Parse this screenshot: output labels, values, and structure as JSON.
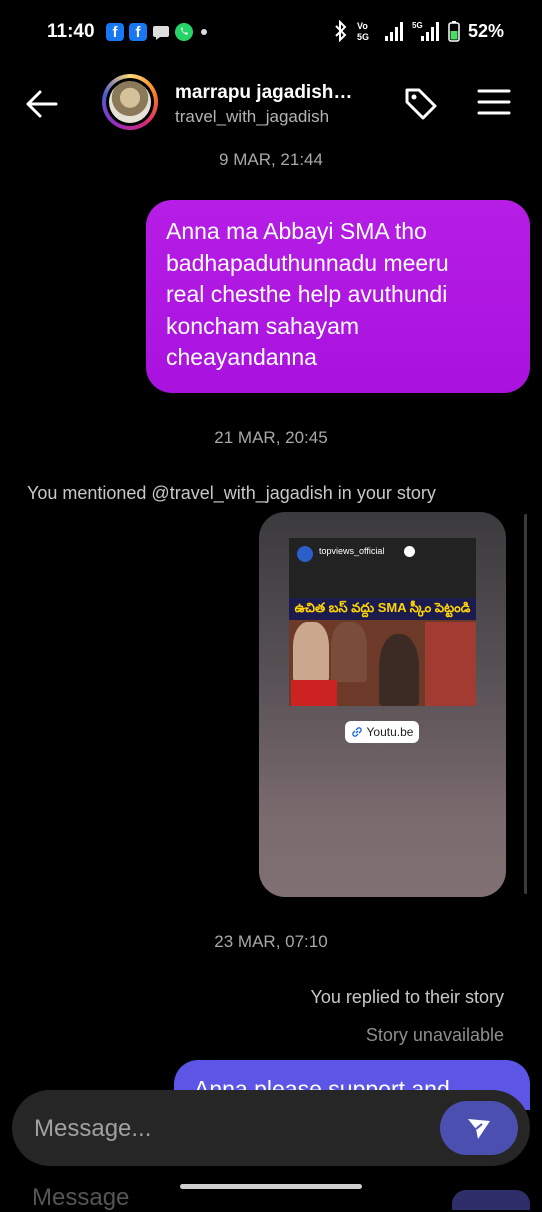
{
  "status_bar": {
    "time": "11:40",
    "battery": "52%",
    "network": "5G",
    "vo_label": "Vo",
    "icons": [
      "facebook-icon",
      "facebook-icon",
      "chat-bubble-icon",
      "whatsapp-icon",
      "dot-icon",
      "bluetooth-icon",
      "volte-icon",
      "signal-icon",
      "signal-5g-icon",
      "battery-icon"
    ]
  },
  "header": {
    "name": "marrapu jagadish…",
    "username": "travel_with_jagadish"
  },
  "thread": {
    "ts1": "9 MAR, 21:44",
    "msg1_lines": [
      "Anna ma Abbayi SMA tho",
      "badhapaduthunnadu meeru",
      "real chesthe help avuthundi",
      "koncham sahayam",
      "cheayandanna"
    ],
    "ts2": "21 MAR, 20:45",
    "mention_note": "You mentioned @travel_with_jagadish in your story",
    "story": {
      "account": "topviews_official",
      "thumb_title": "ఉచిత బస్ వద్దు SMA స్కీం పెట్టండి",
      "link_label": "Youtu.be"
    },
    "ts3": "23 MAR, 07:10",
    "reply_note": "You replied to their story",
    "story_unavailable": "Story unavailable",
    "msg2_partial": "Anna please support and"
  },
  "composer": {
    "placeholder": "Message...",
    "below_text": "Message"
  },
  "colors": {
    "purple_bubble": "#b61ee6",
    "blue_bubble": "#5c55e6",
    "send_button": "#4b4fb0"
  }
}
